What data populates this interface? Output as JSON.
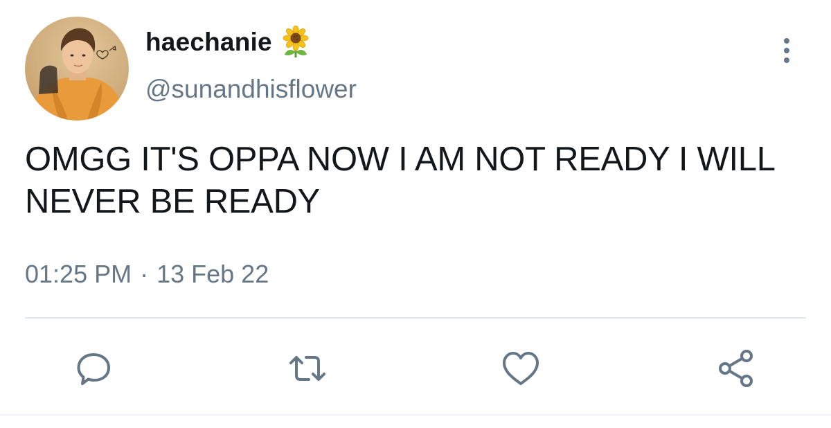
{
  "tweet": {
    "display_name": "haechanie",
    "name_emoji": "sunflower-emoji",
    "handle": "@sunandhisflower",
    "text": "OMGG IT'S OPPA NOW I AM NOT READY I WILL NEVER BE READY",
    "time": "01:25 PM",
    "separator": "·",
    "date": "13 Feb 22"
  },
  "icons": {
    "more": "more-vertical-icon",
    "reply": "reply-icon",
    "retweet": "retweet-icon",
    "like": "heart-icon",
    "share": "share-icon"
  },
  "colors": {
    "primary_text": "#14171a",
    "secondary_text": "#657786",
    "icon": "#657786",
    "divider": "#e1e8ed",
    "background": "#ffffff"
  }
}
